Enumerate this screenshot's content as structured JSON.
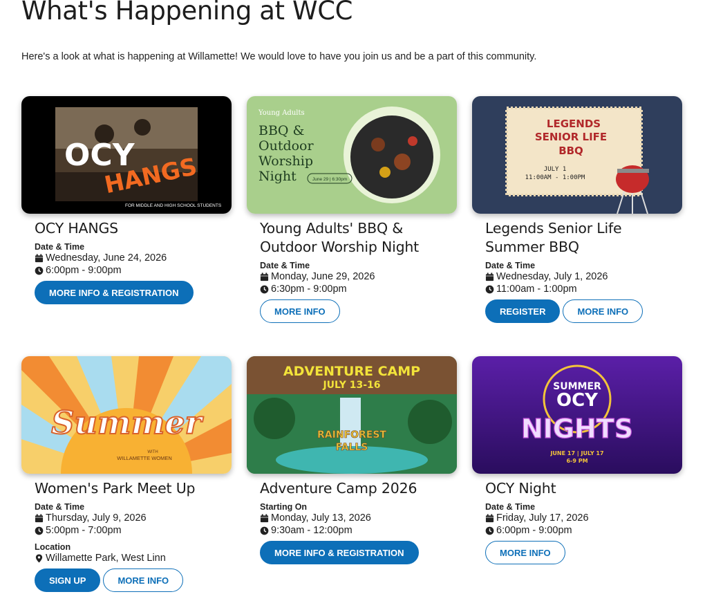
{
  "page": {
    "title": "What's Happening at WCC",
    "intro": "Here's a look at what is happening at Willamette! We would love to have you join us and be a part of this community."
  },
  "events": [
    {
      "title": "OCY HANGS",
      "label": "Date & Time",
      "date": "Wednesday, June 24, 2026",
      "time": "6:00pm - 9:00pm",
      "buttons": [
        "MORE INFO & REGISTRATION"
      ],
      "image_text": {
        "big1": "OCY",
        "big2": "HANGS",
        "caption": "FOR MIDDLE AND HIGH SCHOOL STUDENTS"
      }
    },
    {
      "title": "Young Adults' BBQ & Outdoor Worship Night",
      "label": "Date & Time",
      "date": "Monday, June 29, 2026",
      "time": "6:30pm - 9:00pm",
      "buttons": [
        "MORE INFO"
      ],
      "image_text": {
        "kicker": "Young Adults",
        "l1": "BBQ &",
        "l2": "Outdoor",
        "l3": "Worship",
        "l4": "Night",
        "tag": "June 29 | 6:30pm"
      }
    },
    {
      "title": "Legends Senior Life Summer BBQ",
      "label": "Date & Time",
      "date": "Wednesday, July 1, 2026",
      "time": "11:00am - 1:00pm",
      "buttons": [
        "REGISTER",
        "MORE INFO"
      ],
      "image_text": {
        "l1": "LEGENDS",
        "l2": "SENIOR LIFE",
        "l3": "BBQ",
        "d1": "JULY 1",
        "d2": "11:00AM - 1:00PM"
      }
    },
    {
      "title": "Women's Park Meet Up",
      "label": "Date & Time",
      "date": "Thursday, July 9, 2026",
      "time": "5:00pm - 7:00pm",
      "location_label": "Location",
      "location": "Willamette Park, West Linn",
      "buttons": [
        "SIGN UP",
        "MORE INFO"
      ],
      "image_text": {
        "big": "Summer",
        "s1": "WITH",
        "s2": "WILLAMETTE WOMEN"
      }
    },
    {
      "title": "Adventure Camp 2026",
      "label": "Starting On",
      "date": "Monday, July 13, 2026",
      "time": "9:30am - 12:00pm",
      "buttons": [
        "MORE INFO & REGISTRATION"
      ],
      "image_text": {
        "h1": "ADVENTURE CAMP",
        "h2": "JULY 13-16",
        "l1": "RAINFOREST",
        "l2": "FALLS"
      }
    },
    {
      "title": "OCY Night",
      "label": "Date & Time",
      "date": "Friday, July 17, 2026",
      "time": "6:00pm - 9:00pm",
      "buttons": [
        "MORE INFO"
      ],
      "image_text": {
        "t1": "SUMMER",
        "t2": "OCY",
        "t3": "NIGHTS",
        "d": "JUNE 17 | JULY 17",
        "tm": "6-9 PM"
      }
    }
  ],
  "colors": {
    "brand_blue": "#0d6fb8"
  },
  "icons": {
    "date": "calendar-icon",
    "time": "clock-icon",
    "location": "map-pin-icon"
  }
}
